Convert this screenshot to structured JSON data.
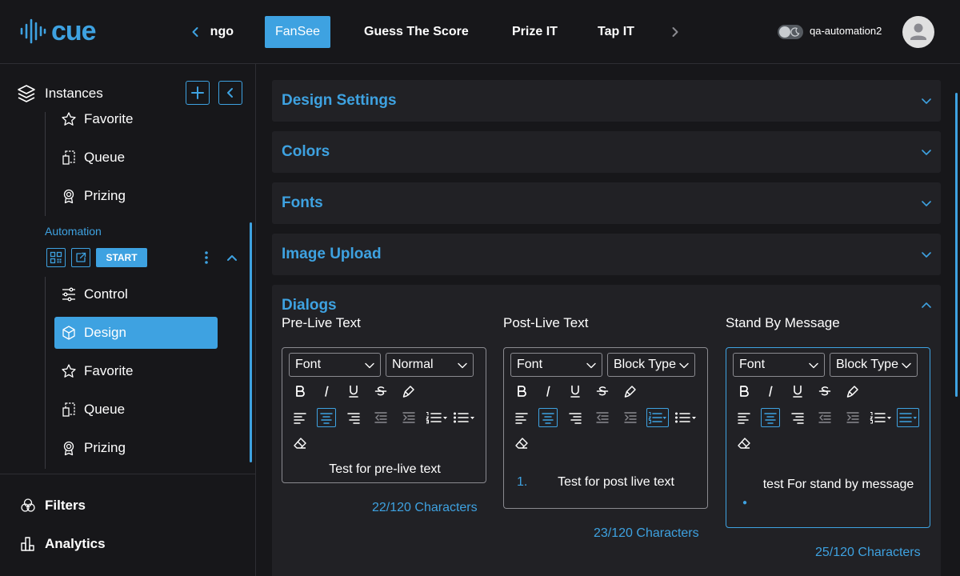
{
  "app": {
    "logo_text": "cue"
  },
  "topnav": {
    "partial_tab": "Bingo",
    "tabs": [
      "FanSee",
      "Guess The Score",
      "Prize IT",
      "Tap IT"
    ],
    "active_tab": "FanSee",
    "username": "qa-automation2"
  },
  "sidebar": {
    "header_title": "Instances",
    "partial_item": "Favorite",
    "items_top": [
      "Queue",
      "Prizing"
    ],
    "section": {
      "name": "Automation",
      "start_label": "START",
      "items": [
        "Control",
        "Design",
        "Favorite",
        "Queue",
        "Prizing"
      ],
      "active_item": "Design"
    },
    "bottom_items": [
      "Filters",
      "Analytics"
    ]
  },
  "main": {
    "accordions": [
      "Design Settings",
      "Colors",
      "Fonts",
      "Image Upload"
    ],
    "dialogs": {
      "title": "Dialogs",
      "columns": [
        {
          "label": "Pre-Live Text",
          "font_select": "Font",
          "type_select": "Normal",
          "content": "Test for pre-live text",
          "count": "22/120 Characters"
        },
        {
          "label": "Post-Live Text",
          "font_select": "Font",
          "type_select": "Block Type",
          "list_marker": "1.",
          "content": "Test for post live text",
          "count": "23/120 Characters"
        },
        {
          "label": "Stand By Message",
          "font_select": "Font",
          "type_select": "Block Type",
          "content": "test For stand by message",
          "count": "25/120 Characters"
        }
      ]
    }
  },
  "colors": {
    "accent": "#3ea2e1",
    "bg": "#17171a",
    "panel": "#212125"
  }
}
